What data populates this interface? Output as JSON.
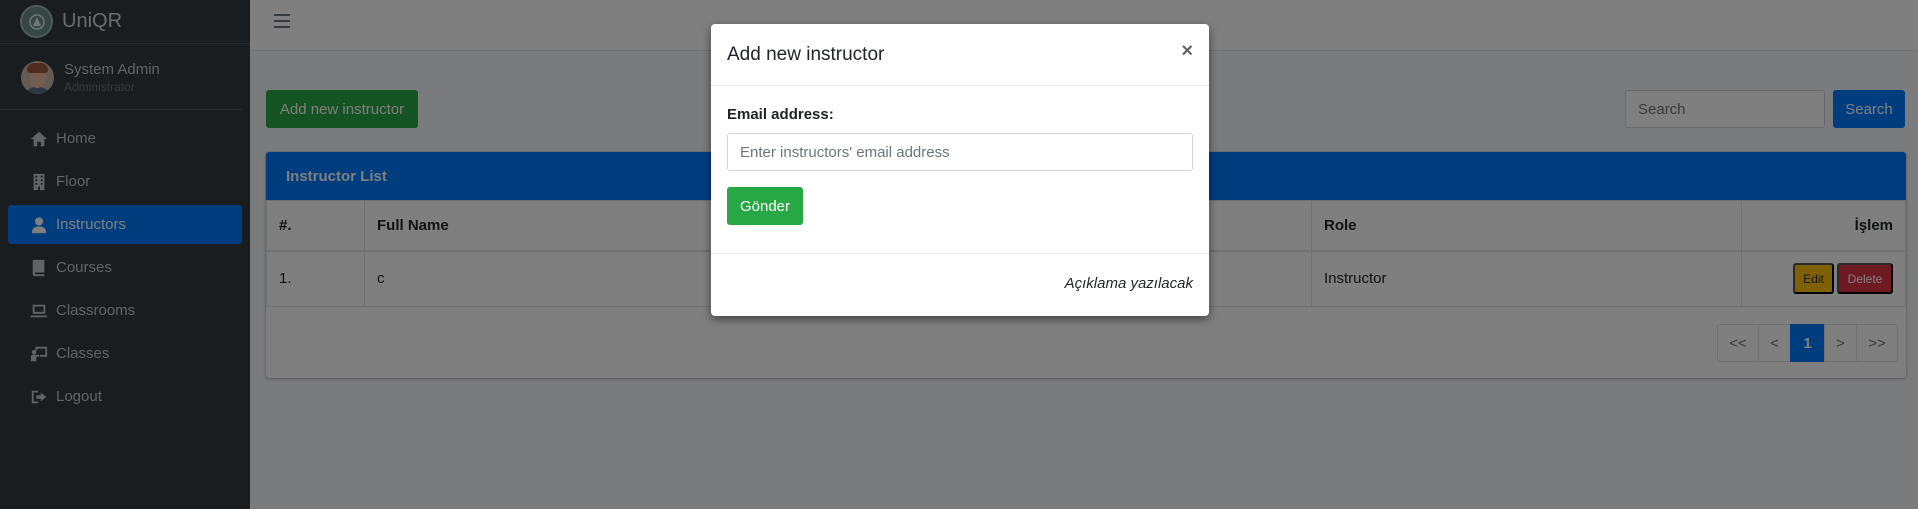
{
  "app": {
    "brand": "UniQR"
  },
  "user": {
    "name": "System Admin",
    "role": "Administrator"
  },
  "sidebar": {
    "items": [
      {
        "label": "Home",
        "icon": "home-icon"
      },
      {
        "label": "Floor",
        "icon": "building-icon"
      },
      {
        "label": "Instructors",
        "icon": "user-icon",
        "active": true
      },
      {
        "label": "Courses",
        "icon": "book-icon"
      },
      {
        "label": "Classrooms",
        "icon": "laptop-icon"
      },
      {
        "label": "Classes",
        "icon": "chalkboard-icon"
      },
      {
        "label": "Logout",
        "icon": "sign-out-icon"
      }
    ]
  },
  "toolbar": {
    "add_label": "Add new instructor",
    "search_placeholder": "Search",
    "search_label": "Search"
  },
  "table": {
    "title": "Instructor List",
    "headers": [
      "#.",
      "Full Name",
      "Role",
      "İşlem"
    ],
    "rows": [
      {
        "num": "1.",
        "name": "c",
        "role": "Instructor",
        "edit": "Edit",
        "delete": "Delete"
      }
    ]
  },
  "pagination": {
    "first": "<<",
    "prev": "<",
    "current": "1",
    "next": ">",
    "last": ">>"
  },
  "modal": {
    "title": "Add new instructor",
    "close": "×",
    "email_label": "Email address:",
    "email_placeholder": "Enter instructors' email address",
    "submit_label": "Gönder",
    "footer_note": "Açıklama yazılacak"
  },
  "colors": {
    "primary": "#007bff",
    "success": "#28a745",
    "warning": "#ffc107",
    "danger": "#dc3545",
    "sidebar": "#343a40"
  }
}
